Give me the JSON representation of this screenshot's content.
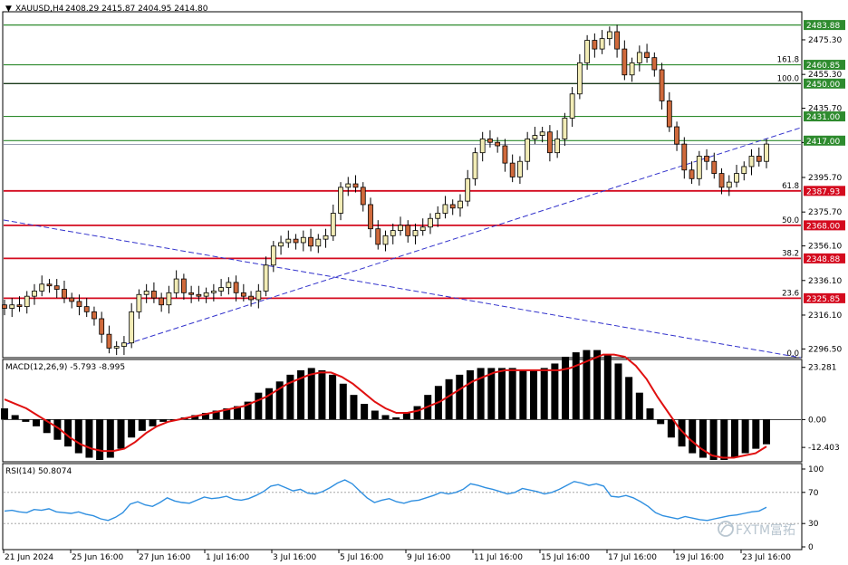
{
  "header": {
    "symbol": "XAUUSD,H4",
    "ohlc": "2408.29 2415.87 2404.95 2414.80",
    "menu_glyph": "▼"
  },
  "macd_label": "MACD(12,26,9) -5.793 -8.995",
  "rsi_label": "RSI(14) 50.8074",
  "watermark": "FXTM富拓",
  "colors": {
    "bull": "#f2ecb6",
    "bear": "#d06a3c",
    "support_line": "#d40a1e",
    "fib_line": "#2e8b2e",
    "trend_line": "#3333cc",
    "macd_hist": "#000000",
    "macd_signal": "#e01010",
    "rsi_line": "#2f8fe0"
  },
  "chart_data": [
    {
      "type": "candlestick",
      "name": "price",
      "y_ticks": [
        "2475.30",
        "2455.30",
        "2435.70",
        "2415.90",
        "2395.70",
        "2375.70",
        "2356.10",
        "2336.10",
        "2316.10",
        "2296.50"
      ],
      "ylim": [
        2292,
        2491
      ],
      "x_labels": [
        "21 Jun 2024",
        "25 Jun 16:00",
        "27 Jun 16:00",
        "1 Jul 16:00",
        "3 Jul 16:00",
        "5 Jul 16:00",
        "9 Jul 16:00",
        "11 Jul 16:00",
        "15 Jul 16:00",
        "17 Jul 16:00",
        "19 Jul 16:00",
        "23 Jul 16:00"
      ],
      "closes": [
        2320,
        2322,
        2321,
        2327,
        2330,
        2334,
        2333,
        2331,
        2326,
        2324,
        2321,
        2318,
        2314,
        2305,
        2297,
        2298,
        2300,
        2318,
        2328,
        2330,
        2326,
        2322,
        2329,
        2337,
        2329,
        2328,
        2327,
        2329,
        2330,
        2332,
        2335,
        2329,
        2327,
        2325,
        2330,
        2345,
        2356,
        2358,
        2360,
        2358,
        2361,
        2356,
        2360,
        2362,
        2375,
        2390,
        2392,
        2390,
        2380,
        2366,
        2357,
        2362,
        2365,
        2368,
        2362,
        2365,
        2367,
        2372,
        2375,
        2380,
        2378,
        2382,
        2395,
        2410,
        2418,
        2416,
        2414,
        2404,
        2396,
        2405,
        2418,
        2420,
        2422,
        2410,
        2418,
        2430,
        2444,
        2462,
        2475,
        2470,
        2476,
        2480,
        2470,
        2455,
        2462,
        2468,
        2465,
        2458,
        2440,
        2425,
        2415,
        2400,
        2395,
        2408,
        2405,
        2398,
        2390,
        2393,
        2398,
        2402,
        2408,
        2405,
        2415
      ],
      "levels": [
        {
          "price": 2483.88,
          "label": "2483.88",
          "kind": "fib",
          "fib": ""
        },
        {
          "price": 2460.85,
          "label": "2460.85",
          "kind": "fib",
          "fib": "161.8"
        },
        {
          "price": 2450.0,
          "label": "2450.00",
          "kind": "fib100",
          "fib": "100.0"
        },
        {
          "price": 2431.0,
          "label": "2431.00",
          "kind": "fib",
          "fib": ""
        },
        {
          "price": 2417.0,
          "label": "2417.00",
          "kind": "fib",
          "fib": ""
        },
        {
          "price": 2387.93,
          "label": "2387.93",
          "kind": "support",
          "fib": "61.8"
        },
        {
          "price": 2368.0,
          "label": "2368.00",
          "kind": "support",
          "fib": "50.0"
        },
        {
          "price": 2348.88,
          "label": "2348.88",
          "kind": "support",
          "fib": "38.2"
        },
        {
          "price": 2325.85,
          "label": "2325.85",
          "kind": "support",
          "fib": "23.6"
        }
      ],
      "current_price": 2414.8,
      "fib_bottom_label": "0.0"
    },
    {
      "type": "bar",
      "name": "MACD(12,26,9)",
      "y_ticks": [
        "23.281",
        "0.00",
        "-12.403"
      ],
      "ylim": [
        -18,
        26
      ],
      "histogram": [
        5,
        2,
        -1,
        -3,
        -6,
        -9,
        -12,
        -15,
        -17,
        -18,
        -17,
        -13,
        -8,
        -5,
        -3,
        -1,
        0,
        1,
        2,
        3,
        4,
        5,
        6,
        8,
        12,
        14,
        17,
        20,
        22,
        23,
        22,
        20,
        16,
        11,
        7,
        4,
        2,
        1,
        3,
        6,
        11,
        15,
        18,
        20,
        22,
        23,
        23,
        23,
        23,
        22,
        22,
        23,
        25,
        28,
        30,
        31,
        31,
        29,
        25,
        19,
        12,
        5,
        -2,
        -8,
        -12,
        -15,
        -17,
        -18,
        -18,
        -17,
        -15,
        -13,
        -11
      ],
      "signal": [
        9,
        7,
        5,
        2,
        -1,
        -4,
        -8,
        -11,
        -13,
        -14,
        -14,
        -13,
        -10,
        -6,
        -3,
        -1,
        0,
        1,
        2,
        3,
        4,
        5,
        6,
        8,
        10,
        13,
        16,
        18,
        20,
        21,
        21,
        19,
        16,
        12,
        8,
        5,
        3,
        3,
        4,
        6,
        8,
        11,
        14,
        17,
        19,
        21,
        22,
        22,
        22,
        22,
        22,
        22,
        23,
        25,
        27,
        29,
        29,
        28,
        24,
        18,
        10,
        3,
        -4,
        -9,
        -13,
        -16,
        -17,
        -17,
        -16,
        -15,
        -12
      ]
    },
    {
      "type": "line",
      "name": "RSI(14)",
      "y_ticks": [
        "100",
        "70",
        "30",
        "0"
      ],
      "ylim": [
        0,
        100
      ],
      "values": [
        46,
        47,
        45,
        44,
        48,
        47,
        49,
        45,
        44,
        43,
        45,
        42,
        40,
        36,
        34,
        38,
        44,
        55,
        58,
        54,
        52,
        57,
        63,
        59,
        57,
        56,
        60,
        64,
        62,
        63,
        65,
        61,
        60,
        62,
        66,
        71,
        78,
        80,
        76,
        72,
        74,
        69,
        68,
        71,
        76,
        82,
        86,
        81,
        72,
        63,
        57,
        60,
        62,
        58,
        56,
        59,
        60,
        63,
        66,
        70,
        68,
        70,
        74,
        81,
        79,
        76,
        74,
        71,
        68,
        70,
        75,
        73,
        71,
        68,
        70,
        74,
        79,
        84,
        82,
        79,
        81,
        78,
        65,
        64,
        66,
        63,
        58,
        52,
        44,
        40,
        38,
        36,
        39,
        37,
        35,
        34,
        36,
        38,
        40,
        41,
        43,
        45,
        46,
        50.8
      ]
    }
  ]
}
